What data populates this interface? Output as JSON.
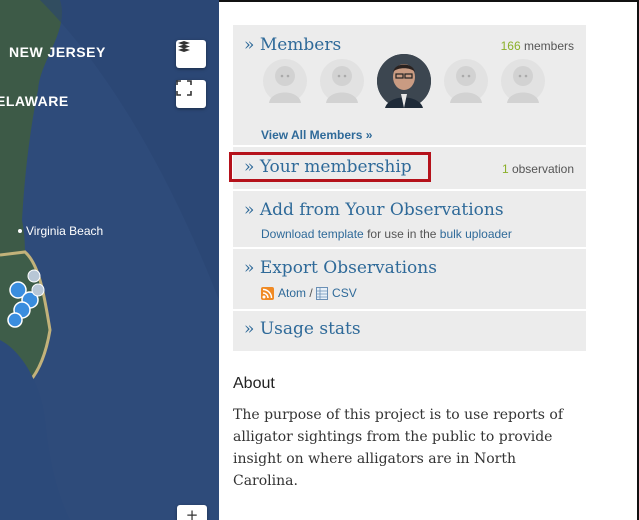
{
  "map": {
    "labels": {
      "new_jersey": "NEW JERSEY",
      "delaware": "ELAWARE",
      "virginia_beach": "Virginia Beach"
    },
    "icons": {
      "layers": "layers-icon",
      "fullscreen": "fullscreen-icon",
      "zoom": "zoom-in-icon"
    },
    "zoom_label": "+"
  },
  "members": {
    "title": "Members",
    "count_number": "166",
    "count_suffix": " members",
    "view_all": "View All Members »",
    "avatars": [
      "placeholder",
      "placeholder",
      "photo",
      "placeholder",
      "placeholder"
    ]
  },
  "membership": {
    "title": "Your membership",
    "count_number": "1",
    "count_suffix": " observation"
  },
  "add": {
    "title": "Add from Your Observations",
    "download_link": "Download template",
    "middle_text": " for use in the ",
    "uploader_link": "bulk uploader"
  },
  "export": {
    "title": "Export Observations",
    "atom": "Atom",
    "sep": " / ",
    "csv": "CSV"
  },
  "usage": {
    "title": "Usage stats"
  },
  "chevron": "»",
  "about": {
    "title": "About",
    "text": "The purpose of this project is to use reports of alligator sightings from the public to provide insight on where alligators are in North Carolina."
  },
  "colors": {
    "ocean": "#2e4b7a",
    "land": "#3d5a47",
    "link": "#2f6a99",
    "highlight_border": "#b5121b",
    "count_green": "#8bb02a",
    "panel_bg": "#ececec"
  }
}
